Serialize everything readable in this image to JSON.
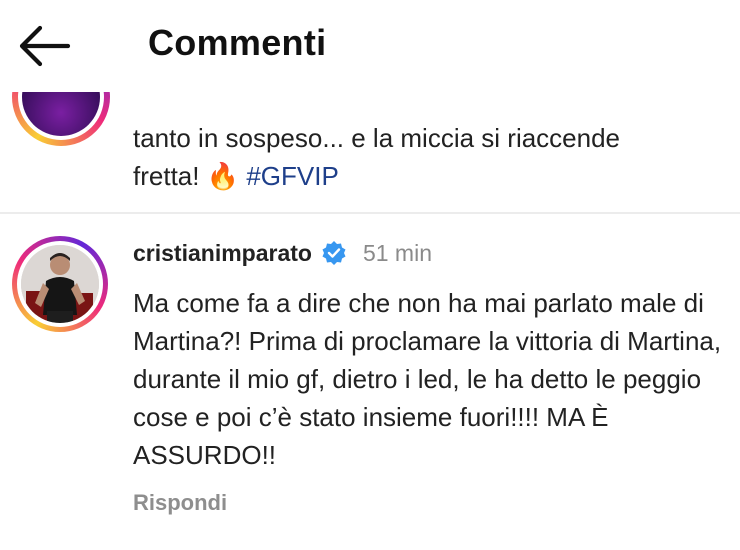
{
  "header": {
    "back_icon": "arrow-left-icon",
    "title": "Commenti"
  },
  "previous_comment": {
    "text_line1": "tanto in sospeso... e la miccia si riaccende",
    "text_line2_start": "fretta! ",
    "emoji": "🔥",
    "hashtag": "#GFVIP"
  },
  "comment": {
    "username": "cristianimparato",
    "verified_icon": "verified-badge-icon",
    "timestamp": "51 min",
    "text": "Ma come fa a dire che non ha mai parlato male di Martina?! Prima di proclamare la vittoria di Martina, durante il mio gf, dietro i led, le ha detto le peggio cose e poi c’è stato insieme fuori!!!! MA È ASSURDO!!",
    "reply_label": "Rispondi"
  },
  "colors": {
    "hashtag": "#1e3f8a",
    "verified": "#3797f0",
    "muted": "#8e8e8e"
  }
}
